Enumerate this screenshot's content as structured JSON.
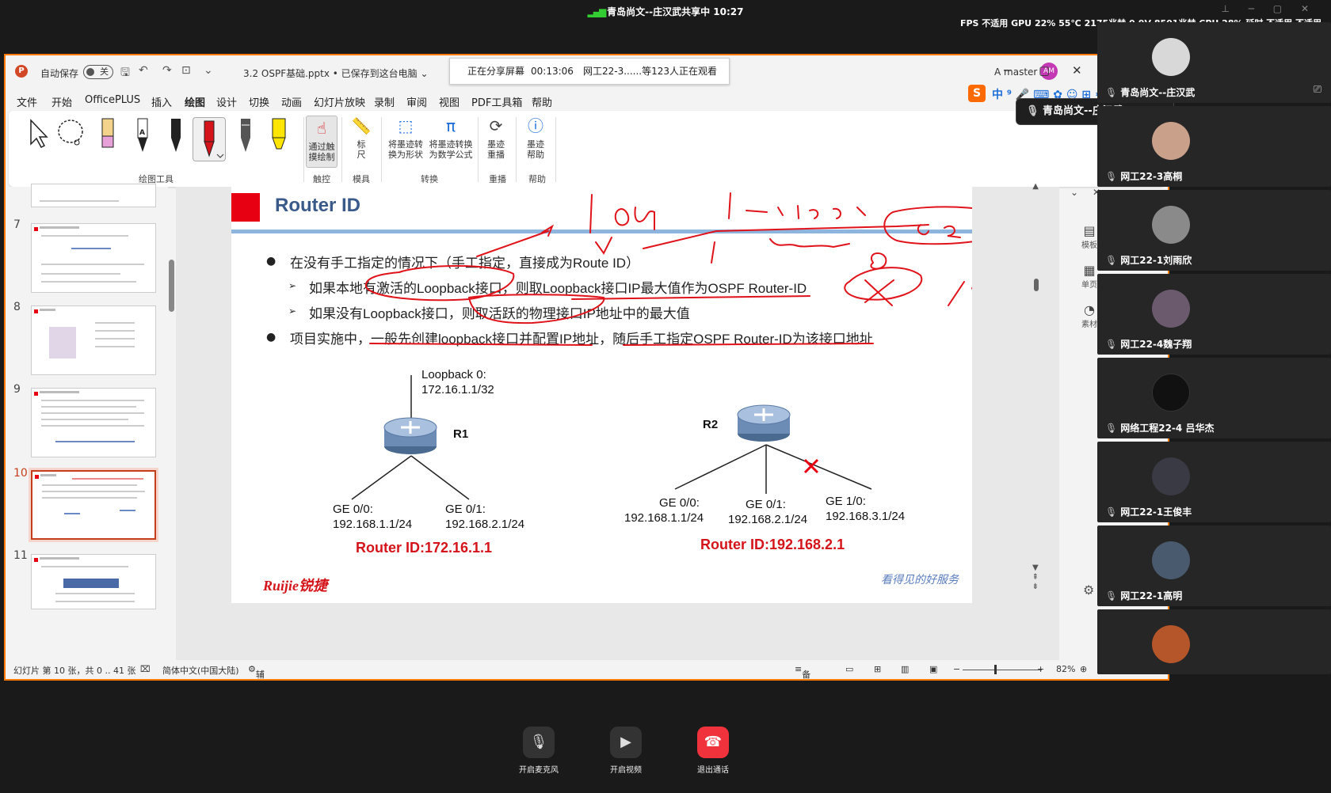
{
  "meeting": {
    "title": "青岛尚文--庄汉武共享中 10:27",
    "perf": "FPS 不适用 GPU 22% 55℃ 2175兆赫 0.9V 8501兆赫 CPU 28% 延时 不适用 不适用"
  },
  "ppt": {
    "autosave": "自动保存",
    "toggle": "关",
    "doc_title": "3.2 OSPF基础.pptx • 已保存到这台电脑 ⌄",
    "sharing": "正在分享屏幕",
    "share_time": "00:13:06",
    "viewers": "网工22-3......等123人正在观看",
    "user": "A master",
    "user_initials": "AM",
    "menu": [
      "文件",
      "开始",
      "OfficePLUS",
      "插入",
      "绘图",
      "设计",
      "切换",
      "动画",
      "幻灯片放映",
      "录制",
      "审阅",
      "视图",
      "PDF工具箱",
      "帮助"
    ],
    "ribbon": {
      "touch_draw": "通过触\n摸绘制",
      "ruler": "标\n尺",
      "ink_shape": "将墨迹转\n换为形状",
      "ink_math": "将墨迹转换\n为数学公式",
      "ink_replay": "墨迹\n重播",
      "ink_help": "墨迹\n帮助",
      "groups": [
        "绘图工具",
        "触控",
        "模具",
        "转换",
        "重播",
        "帮助"
      ]
    },
    "thumb_numbers": [
      "7",
      "8",
      "9",
      "10",
      "11"
    ],
    "status": {
      "slide": "幻灯片 第 10 张，共 0 .. 41 张",
      "lang": "简体中文(中国大陆)",
      "access": "辅助功能: 调查",
      "notes": "备注",
      "zoom": "82%"
    },
    "right_panel": [
      "模板",
      "单页",
      "素材"
    ]
  },
  "slide": {
    "title": "Router ID",
    "b1": "在没有手工指定的情况下（手工指定，直接成为Route ID）",
    "s1": "如果本地有激活的Loopback接口，则取Loopback接口IP最大值作为OSPF Router-ID",
    "s2": "如果没有Loopback接口，则取活跃的物理接口IP地址中的最大值",
    "b2": "项目实施中，一般先创建loopback接口并配置IP地址，随后手工指定OSPF Router-ID为该接口地址",
    "loopback": "Loopback 0:",
    "loopback_ip": "172.16.1.1/32",
    "r1": "R1",
    "r2": "R2",
    "r1_ge00": "GE 0/0:",
    "r1_ge00_ip": "192.168.1.1/24",
    "r1_ge01": "GE 0/1:",
    "r1_ge01_ip": "192.168.2.1/24",
    "r2_ge00": "GE 0/0:",
    "r2_ge00_ip": "192.168.1.1/24",
    "r2_ge01": "GE 0/1:",
    "r2_ge01_ip": "192.168.2.1/24",
    "r2_ge10": "GE 1/0:",
    "r2_ge10_ip": "192.168.3.1/24",
    "rid1": "Router ID:172.16.1.1",
    "rid2": "Router ID:192.168.2.1",
    "brand": "Ruijie锐捷",
    "slogan": "看得见的好服务"
  },
  "participants": [
    {
      "name": "青岛尚文--庄汉武",
      "color": "#d8d8d8"
    },
    {
      "name": "网工22-3高桐",
      "color": "#c9a08a"
    },
    {
      "name": "网工22-1刘雨欣",
      "color": "#8a8a8a"
    },
    {
      "name": "网工22-4魏子翔",
      "color": "#6b5a6e"
    },
    {
      "name": "网络工程22-4 吕华杰",
      "color": "#2a2a2a"
    },
    {
      "name": "网工22-1王俊丰",
      "color": "#3a3a44"
    },
    {
      "name": "网工22-1高明",
      "color": "#4a5a6e"
    },
    {
      "name": "",
      "color": "#b5552a"
    }
  ],
  "tooltip": "青岛尚文--庄汉武",
  "controls": {
    "mic": "开启麦克风",
    "video": "开启视频",
    "leave": "退出通话"
  }
}
